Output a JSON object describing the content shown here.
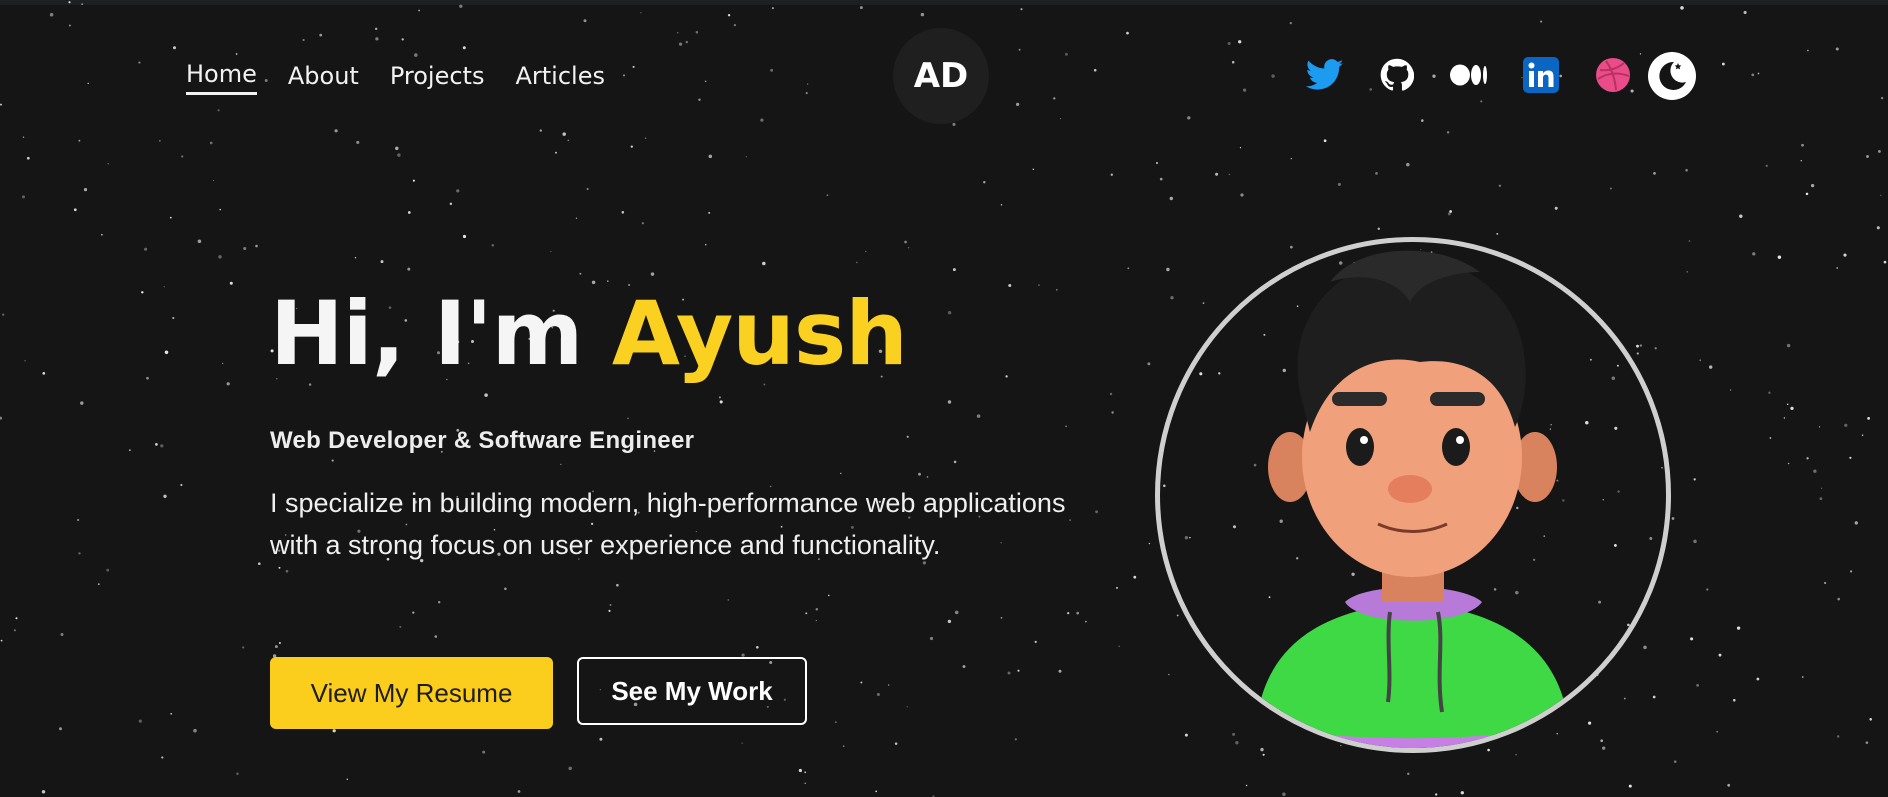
{
  "nav": {
    "links": [
      {
        "label": "Home"
      },
      {
        "label": "About"
      },
      {
        "label": "Projects"
      },
      {
        "label": "Articles"
      }
    ]
  },
  "logo": {
    "text": "AD"
  },
  "social": {
    "icons": [
      "twitter-icon",
      "github-icon",
      "medium-icon",
      "linkedin-icon",
      "dribbble-icon"
    ],
    "colors": {
      "twitter": "#1d9bf0",
      "github": "#ffffff",
      "medium": "#ffffff",
      "linkedin": "#0a66c2",
      "dribbble": "#ea4c89"
    }
  },
  "theme_toggle": {
    "icon": "moon-icon"
  },
  "hero": {
    "greeting": "Hi, I'm",
    "name": "Ayush",
    "subtitle": "Web Developer & Software Engineer",
    "description": "I specialize in building modern, high-performance web applications with a strong focus on user experience and functionality.",
    "primary_button": "View My Resume",
    "secondary_button": "See My Work"
  },
  "colors": {
    "background": "#151515",
    "accent": "#fbd121",
    "text": "#f5f5f5"
  }
}
